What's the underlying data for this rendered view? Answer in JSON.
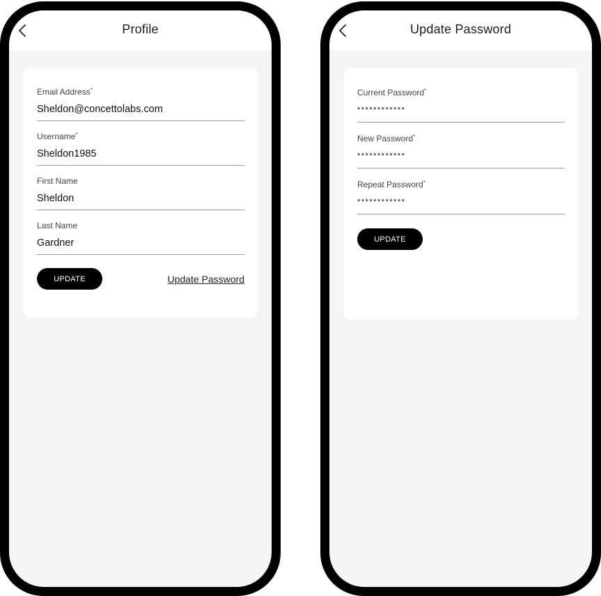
{
  "profile_screen": {
    "title": "Profile",
    "back_icon": "chevron-left-icon",
    "fields": [
      {
        "label": "Email Address",
        "required": true,
        "value": "Sheldon@concettolabs.com"
      },
      {
        "label": "Username",
        "required": true,
        "value": "Sheldon1985"
      },
      {
        "label": "First Name",
        "required": false,
        "value": "Sheldon"
      },
      {
        "label": "Last Name",
        "required": false,
        "value": "Gardner"
      }
    ],
    "update_button": "UPDATE",
    "update_password_link": "Update Password"
  },
  "password_screen": {
    "title": "Update Password",
    "back_icon": "chevron-left-icon",
    "fields": [
      {
        "label": "Current Password",
        "required": true,
        "value": "************"
      },
      {
        "label": "New Password",
        "required": true,
        "value": "************"
      },
      {
        "label": "Repeat Password",
        "required": true,
        "value": "************"
      }
    ],
    "update_button": "UPDATE"
  },
  "required_marker": "*",
  "colors": {
    "frame": "#000000",
    "background": "#f5f5f5",
    "card": "#ffffff",
    "button": "#000000",
    "button_text": "#ffffff"
  }
}
